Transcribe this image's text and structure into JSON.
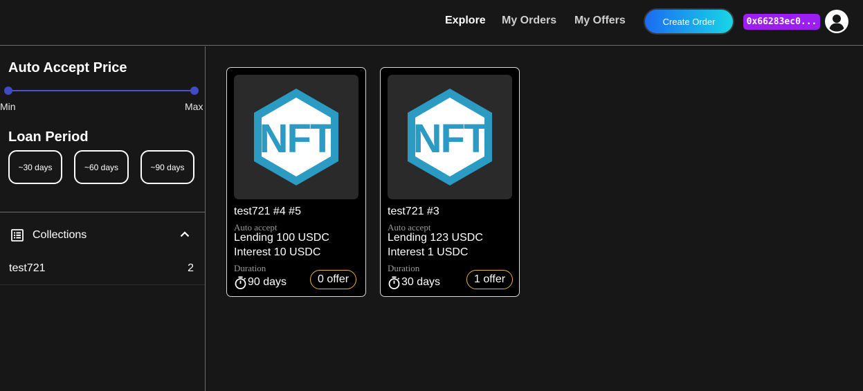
{
  "nav": {
    "explore": "Explore",
    "my_orders": "My Orders",
    "my_offers": "My Offers",
    "create_order": "Create Order",
    "wallet_address": "0x66283ec0...",
    "avatar_icon": "account-circle-icon"
  },
  "sidebar": {
    "auto_accept_title": "Auto Accept Price",
    "slider": {
      "min_label": "Min",
      "max_label": "Max"
    },
    "loan_period_title": "Loan Period",
    "periods": [
      "~30 days",
      "~60 days",
      "~90 days"
    ],
    "collections_label": "Collections",
    "collections": [
      {
        "name": "test721",
        "count": "2"
      }
    ]
  },
  "cards": [
    {
      "title": "test721 #4 #5",
      "auto_accept_label": "Auto accept",
      "lending": "Lending 100 USDC",
      "interest": "Interest 10 USDC",
      "duration_label": "Duration",
      "duration": "90 days",
      "offers": "0 offer",
      "logo_text": "NFT"
    },
    {
      "title": "test721 #3",
      "auto_accept_label": "Auto accept",
      "lending": "Lending 123 USDC",
      "interest": "Interest 1 USDC",
      "duration_label": "Duration",
      "duration": "30 days",
      "offers": "1 offer",
      "logo_text": "NFT"
    }
  ],
  "colors": {
    "background": "#171717",
    "accent_slider": "#4a56c9",
    "wallet_badge": "#9a1ff0",
    "offer_border": "#e2b834",
    "nft_logo_blue": "#2b9bc4",
    "nft_logo_teal": "#3ec6a0"
  }
}
